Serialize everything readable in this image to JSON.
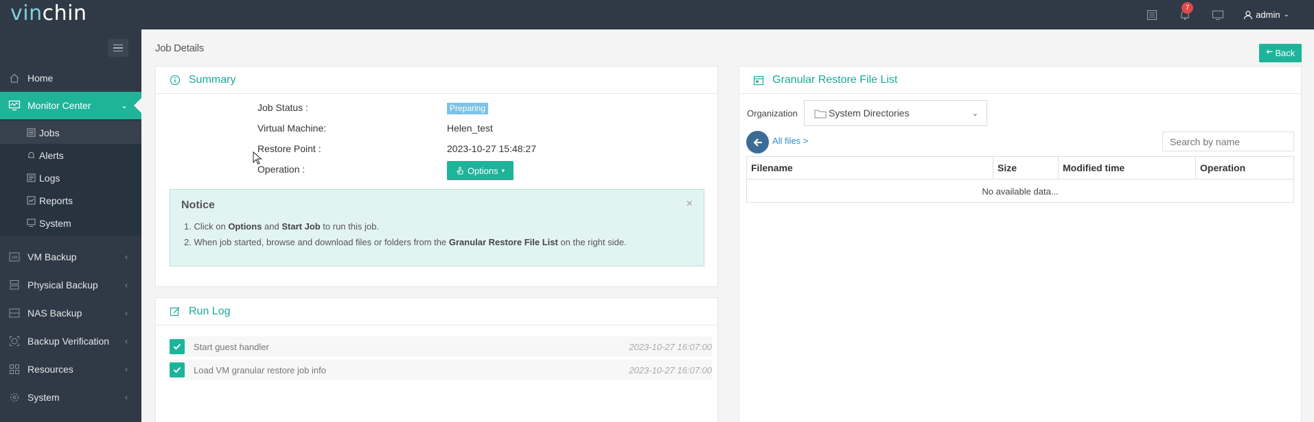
{
  "app": {
    "logo_part1": "vin",
    "logo_part2": "chin"
  },
  "topbar": {
    "notification_count": "7",
    "user": "admin"
  },
  "sidebar": {
    "items": [
      {
        "label": "Home",
        "icon": "home-icon"
      },
      {
        "label": "Monitor Center",
        "icon": "monitor-icon",
        "active": true
      },
      {
        "label": "VM Backup",
        "icon": "vm-icon"
      },
      {
        "label": "Physical Backup",
        "icon": "server-icon"
      },
      {
        "label": "NAS Backup",
        "icon": "nas-icon"
      },
      {
        "label": "Backup Verification",
        "icon": "verify-icon"
      },
      {
        "label": "Resources",
        "icon": "grid-icon"
      },
      {
        "label": "System",
        "icon": "gear-icon"
      }
    ],
    "sub_items": [
      {
        "label": "Jobs",
        "icon": "list-icon",
        "current": true
      },
      {
        "label": "Alerts",
        "icon": "bell-icon"
      },
      {
        "label": "Logs",
        "icon": "log-icon"
      },
      {
        "label": "Reports",
        "icon": "report-icon"
      },
      {
        "label": "System",
        "icon": "monitor-small-icon"
      }
    ]
  },
  "page": {
    "title": "Job Details",
    "back_label": "Back"
  },
  "summary": {
    "title": "Summary",
    "job_status_label": "Job Status :",
    "job_status_value": "Preparing",
    "vm_label": "Virtual Machine:",
    "vm_value": "Helen_test",
    "restore_point_label": "Restore Point :",
    "restore_point_value": "2023-10-27 15:48:27",
    "operation_label": "Operation :",
    "options_label": "Options",
    "notice": {
      "title": "Notice",
      "line1_a": "1. Click on ",
      "line1_b": "Options",
      "line1_c": " and ",
      "line1_d": "Start Job",
      "line1_e": " to run this job.",
      "line2_a": "2. When job started, browse and download files or folders from the ",
      "line2_b": "Granular Restore File List",
      "line2_c": " on the right side."
    }
  },
  "run_log": {
    "title": "Run Log",
    "entries": [
      {
        "text": "Start guest handler",
        "time": "2023-10-27 16:07:00"
      },
      {
        "text": "Load VM granular restore job info",
        "time": "2023-10-27 16:07:00"
      }
    ]
  },
  "file_list": {
    "title": "Granular Restore File List",
    "organization_label": "Organization",
    "organization_value": "System Directories",
    "all_files": "All files >",
    "search_placeholder": "Search by name",
    "columns": [
      "Filename",
      "Size",
      "Modified time",
      "Operation"
    ],
    "empty_text": "No available data..."
  },
  "colors": {
    "accent": "#1db49a",
    "sidebar": "#2f3a46",
    "title_teal": "#1aa89a",
    "status_badge": "#7ec2e6"
  }
}
